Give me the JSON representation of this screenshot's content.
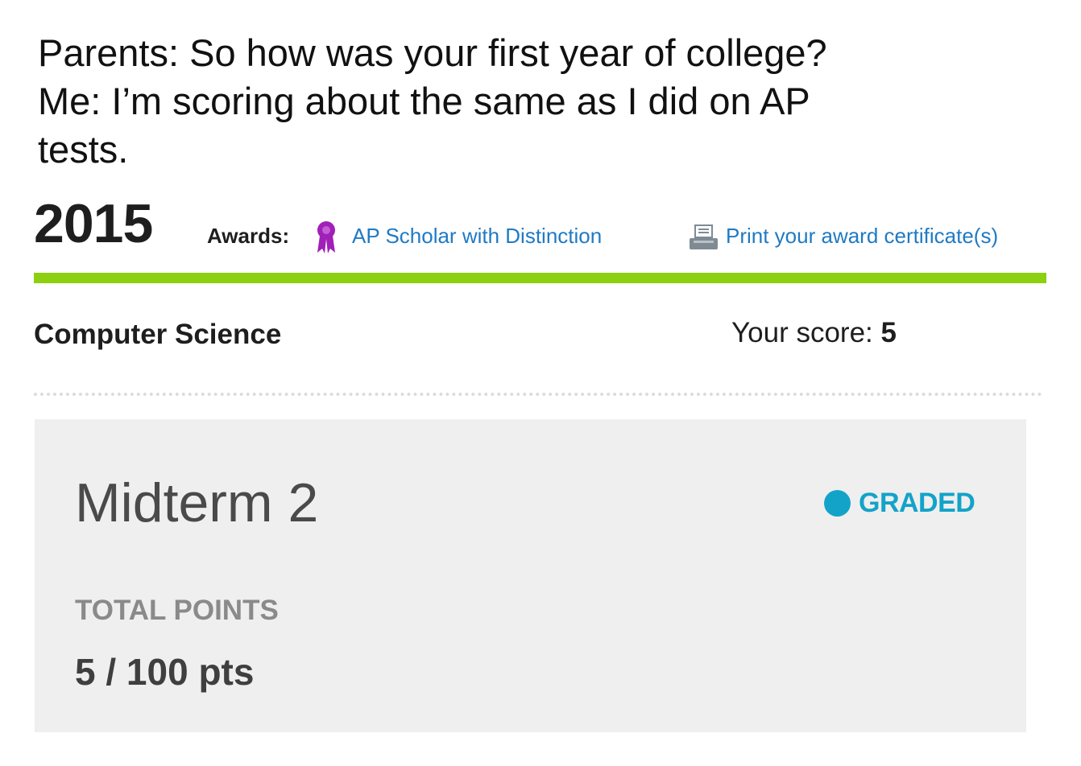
{
  "caption": {
    "lines": [
      "Parents: So how was your first year of college?",
      "Me: I’m scoring about the same as I did on AP",
      "tests."
    ]
  },
  "ap_report": {
    "year": "2015",
    "awards_label": "Awards:",
    "award_icon": "ribbon-award-icon",
    "award_name": "AP Scholar with Distinction",
    "print_icon": "printer-icon",
    "print_link": "Print your award certificate(s)",
    "accent_color": "#8cd00f",
    "link_color": "#1f7ac4",
    "award_icon_color": "#a020b8",
    "subject": "Computer Science",
    "score_label": "Your score:",
    "score_value": "5"
  },
  "grade_card": {
    "title": "Midterm 2",
    "status_icon": "status-dot-icon",
    "status": "GRADED",
    "status_color": "#13a3c9",
    "total_points_label": "TOTAL POINTS",
    "total_points_value": "5 / 100 pts",
    "background_color": "#efefef"
  }
}
